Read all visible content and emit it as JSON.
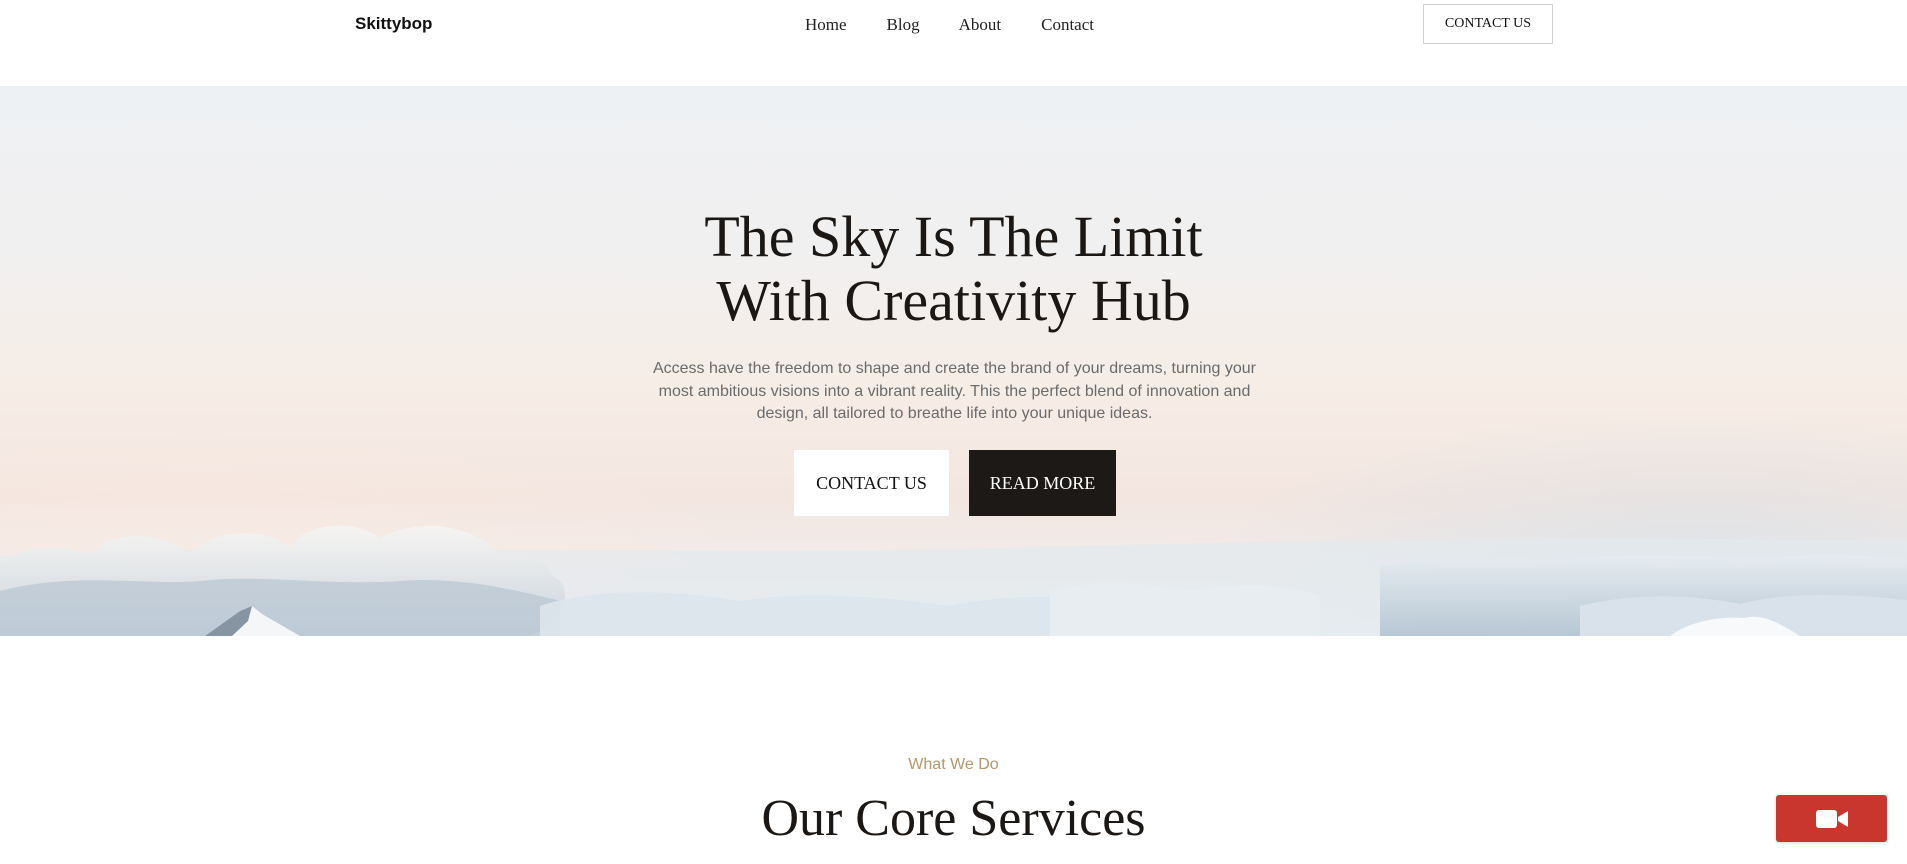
{
  "header": {
    "brand": "Skittybop",
    "nav": [
      "Home",
      "Blog",
      "About",
      "Contact"
    ],
    "cta_label": "CONTACT US"
  },
  "hero": {
    "title_line_1": "The Sky Is The Limit",
    "title_line_2": "With Creativity Hub",
    "subtitle": "Access have the freedom to shape and create the brand of your dreams, turning your most ambitious visions into a vibrant reality. This the perfect blend of innovation and design, all tailored to breathe life into your unique ideas.",
    "primary_button": "CONTACT US",
    "secondary_button": "READ MORE"
  },
  "services": {
    "kicker": "What We Do",
    "title": "Our Core Services"
  },
  "video_button": {
    "icon": "video-camera-icon"
  },
  "colors": {
    "accent": "#b5976b",
    "dark": "#1c1917",
    "video_button": "#c9362d"
  }
}
